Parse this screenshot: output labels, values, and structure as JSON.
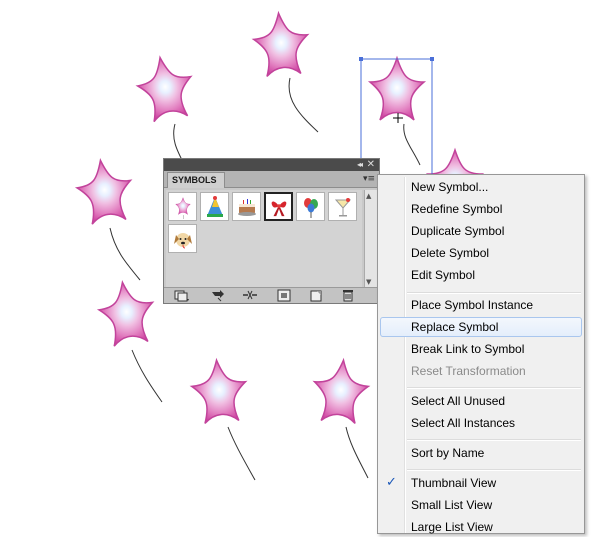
{
  "panel": {
    "tab_label": "SYMBOLS",
    "collapse_glyph": "◂◂",
    "close_glyph": "✕",
    "menu_glyph": "▾≡",
    "symbols": [
      {
        "name": "star-balloon-symbol",
        "selected": false
      },
      {
        "name": "party-hat-symbol",
        "selected": false
      },
      {
        "name": "cake-symbol",
        "selected": false
      },
      {
        "name": "gift-bow-symbol",
        "selected": true
      },
      {
        "name": "balloons-symbol",
        "selected": false
      },
      {
        "name": "cocktail-glass-symbol",
        "selected": false
      },
      {
        "name": "dog-face-symbol",
        "selected": false
      }
    ],
    "footer_icons": [
      "symbol-libraries-icon",
      "place-instance-icon",
      "break-link-icon",
      "symbol-options-icon",
      "new-symbol-icon",
      "delete-symbol-icon"
    ]
  },
  "context_menu": {
    "items": [
      {
        "label": "New Symbol...",
        "disabled": false
      },
      {
        "label": "Redefine Symbol",
        "disabled": false
      },
      {
        "label": "Duplicate Symbol",
        "disabled": false
      },
      {
        "label": "Delete Symbol",
        "disabled": false
      },
      {
        "label": "Edit Symbol",
        "disabled": false
      },
      {
        "label": "Place Symbol Instance",
        "disabled": false
      },
      {
        "label": "Replace Symbol",
        "disabled": false,
        "highlighted": true
      },
      {
        "label": "Break Link to Symbol",
        "disabled": false
      },
      {
        "label": "Reset Transformation",
        "disabled": true
      },
      {
        "label": "Select All Unused",
        "disabled": false
      },
      {
        "label": "Select All Instances",
        "disabled": false
      },
      {
        "label": "Sort by Name",
        "disabled": false
      },
      {
        "label": "Thumbnail View",
        "disabled": false,
        "checked": true
      },
      {
        "label": "Small List View",
        "disabled": false
      },
      {
        "label": "Large List View",
        "disabled": false
      }
    ],
    "check_glyph": "✓"
  },
  "colors": {
    "star_outer": "#d453a8",
    "star_mid": "#e591c8",
    "star_inner": "#f3c8e5",
    "star_core": "#ffffff",
    "selection_blue": "#4a6fd8",
    "menu_highlight_border": "#a9c6ee"
  }
}
